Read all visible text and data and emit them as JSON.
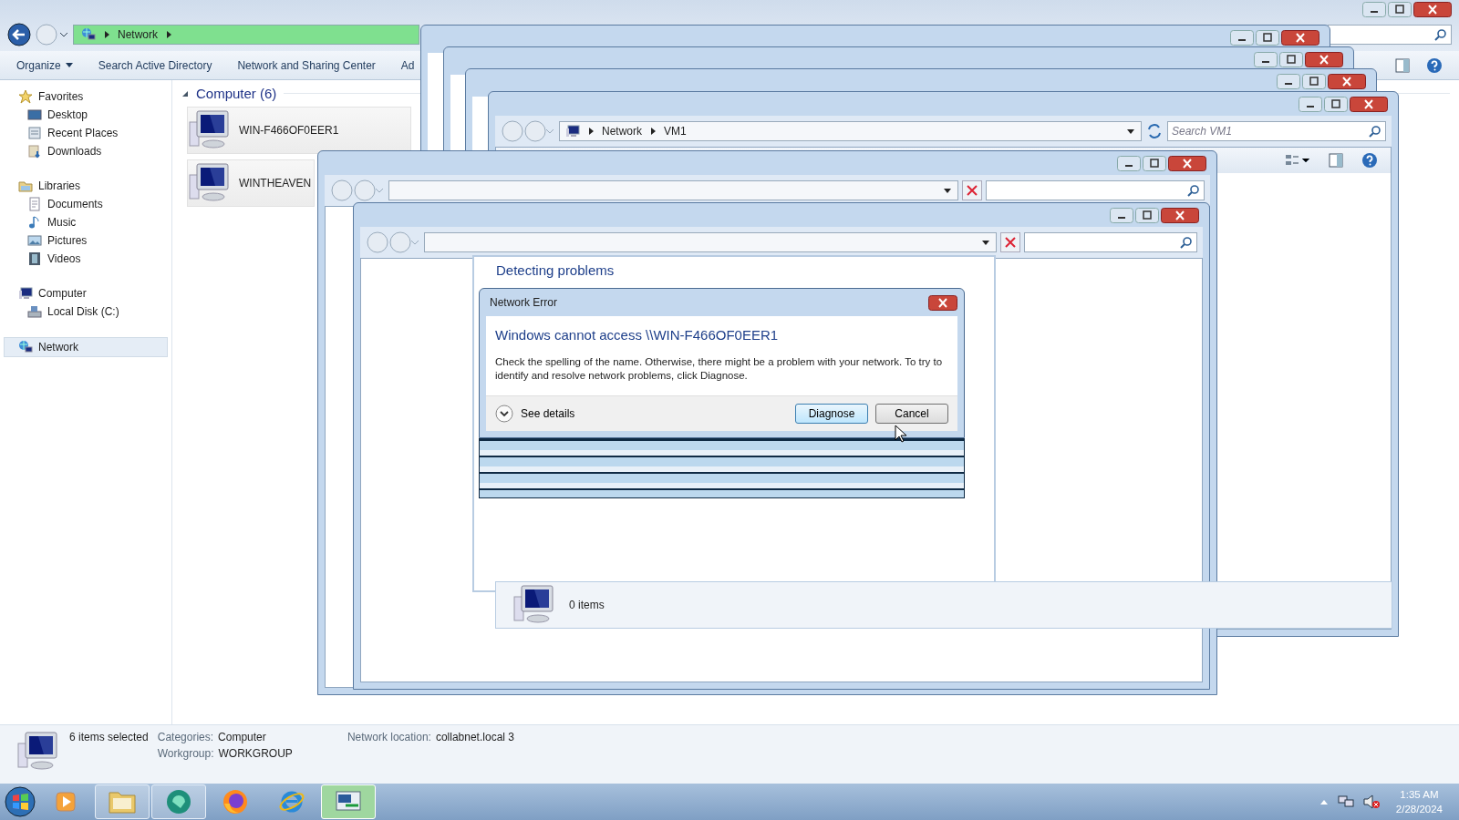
{
  "explorer": {
    "address": [
      "Network"
    ],
    "toolbar": [
      "Organize",
      "Search Active Directory",
      "Network and Sharing Center",
      "Ad"
    ],
    "sidebar": [
      {
        "label": "Favorites",
        "kind": "star",
        "selected": false,
        "children": [
          {
            "label": "Desktop",
            "kind": "desktop",
            "selected": false
          },
          {
            "label": "Recent Places",
            "kind": "recent",
            "selected": false
          },
          {
            "label": "Downloads",
            "kind": "downloads",
            "selected": false
          }
        ]
      },
      {
        "label": "Libraries",
        "kind": "library",
        "selected": false,
        "children": [
          {
            "label": "Documents",
            "kind": "documents",
            "selected": false
          },
          {
            "label": "Music",
            "kind": "music",
            "selected": false
          },
          {
            "label": "Pictures",
            "kind": "pictures",
            "selected": false
          },
          {
            "label": "Videos",
            "kind": "videos",
            "selected": false
          }
        ]
      },
      {
        "label": "Computer",
        "kind": "computer",
        "selected": false,
        "children": [
          {
            "label": "Local Disk (C:)",
            "kind": "disk",
            "selected": false
          }
        ]
      },
      {
        "label": "Network",
        "kind": "network",
        "selected": true
      }
    ],
    "group": {
      "title": "Computer (6)",
      "expanded": true
    },
    "items": [
      {
        "label": "WIN-F466OF0EER1"
      },
      {
        "label": "WINTHEAVEN"
      }
    ],
    "status": {
      "selection": "6 items selected",
      "fields": [
        {
          "label": "Categories:",
          "value": "Computer"
        },
        {
          "label": "Workgroup:",
          "value": "WORKGROUP"
        }
      ],
      "location_label": "Network location:",
      "location": "collabnet.local 3"
    }
  },
  "windows": [
    {
      "kind": "frame"
    },
    {
      "kind": "frame"
    },
    {
      "kind": "frame"
    },
    {
      "kind": "explorer",
      "address": [
        "Network",
        "VM1"
      ],
      "placeholder": "Search VM1",
      "status": "0 items"
    },
    {
      "kind": "browser"
    },
    {
      "kind": "browser"
    },
    {
      "kind": "wizard",
      "heading": "Detecting problems"
    }
  ],
  "dialog": {
    "title": "Network Error",
    "heading": "Windows cannot access \\\\WIN-F466OF0EER1",
    "message": "Check the spelling of the name. Otherwise, there might be a problem with your network. To try to identify and resolve network problems, click Diagnose.",
    "details": {
      "label": "See details",
      "expanded": false
    },
    "buttons": [
      {
        "label": "Diagnose",
        "default": true
      },
      {
        "label": "Cancel",
        "default": false
      }
    ]
  },
  "taskbar": {
    "apps": [
      {
        "kind": "media",
        "running": false,
        "selected": false
      },
      {
        "kind": "folder",
        "running": true,
        "selected": false
      },
      {
        "kind": "circle",
        "running": true,
        "selected": false
      },
      {
        "kind": "firefox",
        "running": false,
        "selected": false
      },
      {
        "kind": "ie",
        "running": false,
        "selected": false
      },
      {
        "kind": "remote",
        "running": true,
        "selected": true
      }
    ],
    "clock": {
      "time": "1:35 AM",
      "date": "2/28/2024"
    }
  }
}
